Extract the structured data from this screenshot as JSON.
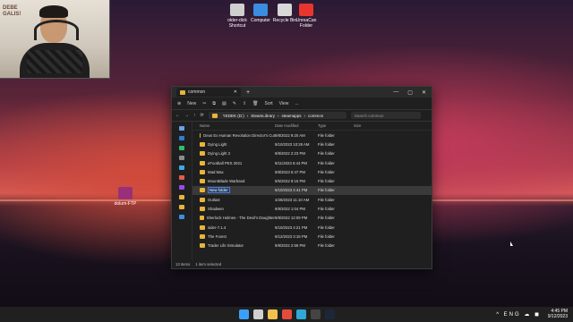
{
  "webcam": {
    "wall_text": "DEBE\nGALIS!"
  },
  "desktop_icons": [
    {
      "label": "older-dick\nShortcut",
      "icon": "tool-icon",
      "color": "#cfcfcf"
    },
    {
      "label": "Computer",
      "icon": "computer-icon",
      "color": "#3b8de0"
    },
    {
      "label": "Recycle Bin",
      "icon": "recycle-bin-icon",
      "color": "#d8d8d8"
    },
    {
      "label": "UnreaCan\nFolder",
      "icon": "folder-icon",
      "color": "#e8362f"
    },
    {
      "label": "dolum-FTP",
      "icon": "winrar-icon",
      "color": "#9a2f7a"
    }
  ],
  "explorer": {
    "tab_title": "common",
    "cmd": {
      "new": "New",
      "sort": "Sort",
      "view": "View",
      "more": "..."
    },
    "breadcrumb": [
      "YEDEK (D:)",
      "SteamLibrary",
      "steamapps",
      "common"
    ],
    "search_placeholder": "Search common",
    "columns": {
      "name": "Name",
      "date": "Date modified",
      "type": "Type",
      "size": "Size"
    },
    "rows": [
      {
        "name": "Deus Ex Human Revolution Director's Cut",
        "date": "9/8/2022 9:20 AM",
        "type": "File folder",
        "selected": false
      },
      {
        "name": "Dying Light",
        "date": "9/10/2023 10:28 AM",
        "type": "File folder",
        "selected": false
      },
      {
        "name": "Dying Light 2",
        "date": "9/8/2022 2:23 PM",
        "type": "File folder",
        "selected": false
      },
      {
        "name": "eFootball PES 2021",
        "date": "9/11/2023 6:44 PM",
        "type": "File folder",
        "selected": false
      },
      {
        "name": "Mad Max",
        "date": "9/8/2023 5:47 PM",
        "type": "File folder",
        "selected": false
      },
      {
        "name": "MountBlade Warband",
        "date": "9/5/2022 9:15 PM",
        "type": "File folder",
        "selected": false
      },
      {
        "name": "New folder",
        "date": "9/10/2023 4:41 PM",
        "type": "File folder",
        "selected": true
      },
      {
        "name": "Outlast",
        "date": "4/28/2023 11:10 AM",
        "type": "File folder",
        "selected": false
      },
      {
        "name": "Shadwen",
        "date": "9/8/2022 1:04 PM",
        "type": "File folder",
        "selected": false
      },
      {
        "name": "Sherlock Holmes - The Devil's Daughter",
        "date": "9/8/2022 12:09 PM",
        "type": "File folder",
        "selected": false
      },
      {
        "name": "sider-7.1.4",
        "date": "9/10/2023 4:21 PM",
        "type": "File folder",
        "selected": false
      },
      {
        "name": "The Forest",
        "date": "9/12/2023 3:18 PM",
        "type": "File folder",
        "selected": false
      },
      {
        "name": "Trader Life Simulator",
        "date": "9/8/2022 2:59 PM",
        "type": "File folder",
        "selected": false
      }
    ],
    "status": {
      "count": "13 items",
      "selected": "1 item selected"
    }
  },
  "taskbar": {
    "apps": [
      {
        "icon": "start-icon",
        "color": "#3aa0ff"
      },
      {
        "icon": "search-icon",
        "color": "#cfcfcf"
      },
      {
        "icon": "file-explorer-icon",
        "color": "#f2c14e"
      },
      {
        "icon": "chrome-icon",
        "color": "#e34b3d"
      },
      {
        "icon": "edge-icon",
        "color": "#2fa8d8"
      },
      {
        "icon": "obs-icon",
        "color": "#444444"
      },
      {
        "icon": "steam-icon",
        "color": "#1b2838"
      }
    ],
    "time": "4:45 PM",
    "date": "9/12/2023",
    "tray": "^ ENG ☁ ◼"
  }
}
